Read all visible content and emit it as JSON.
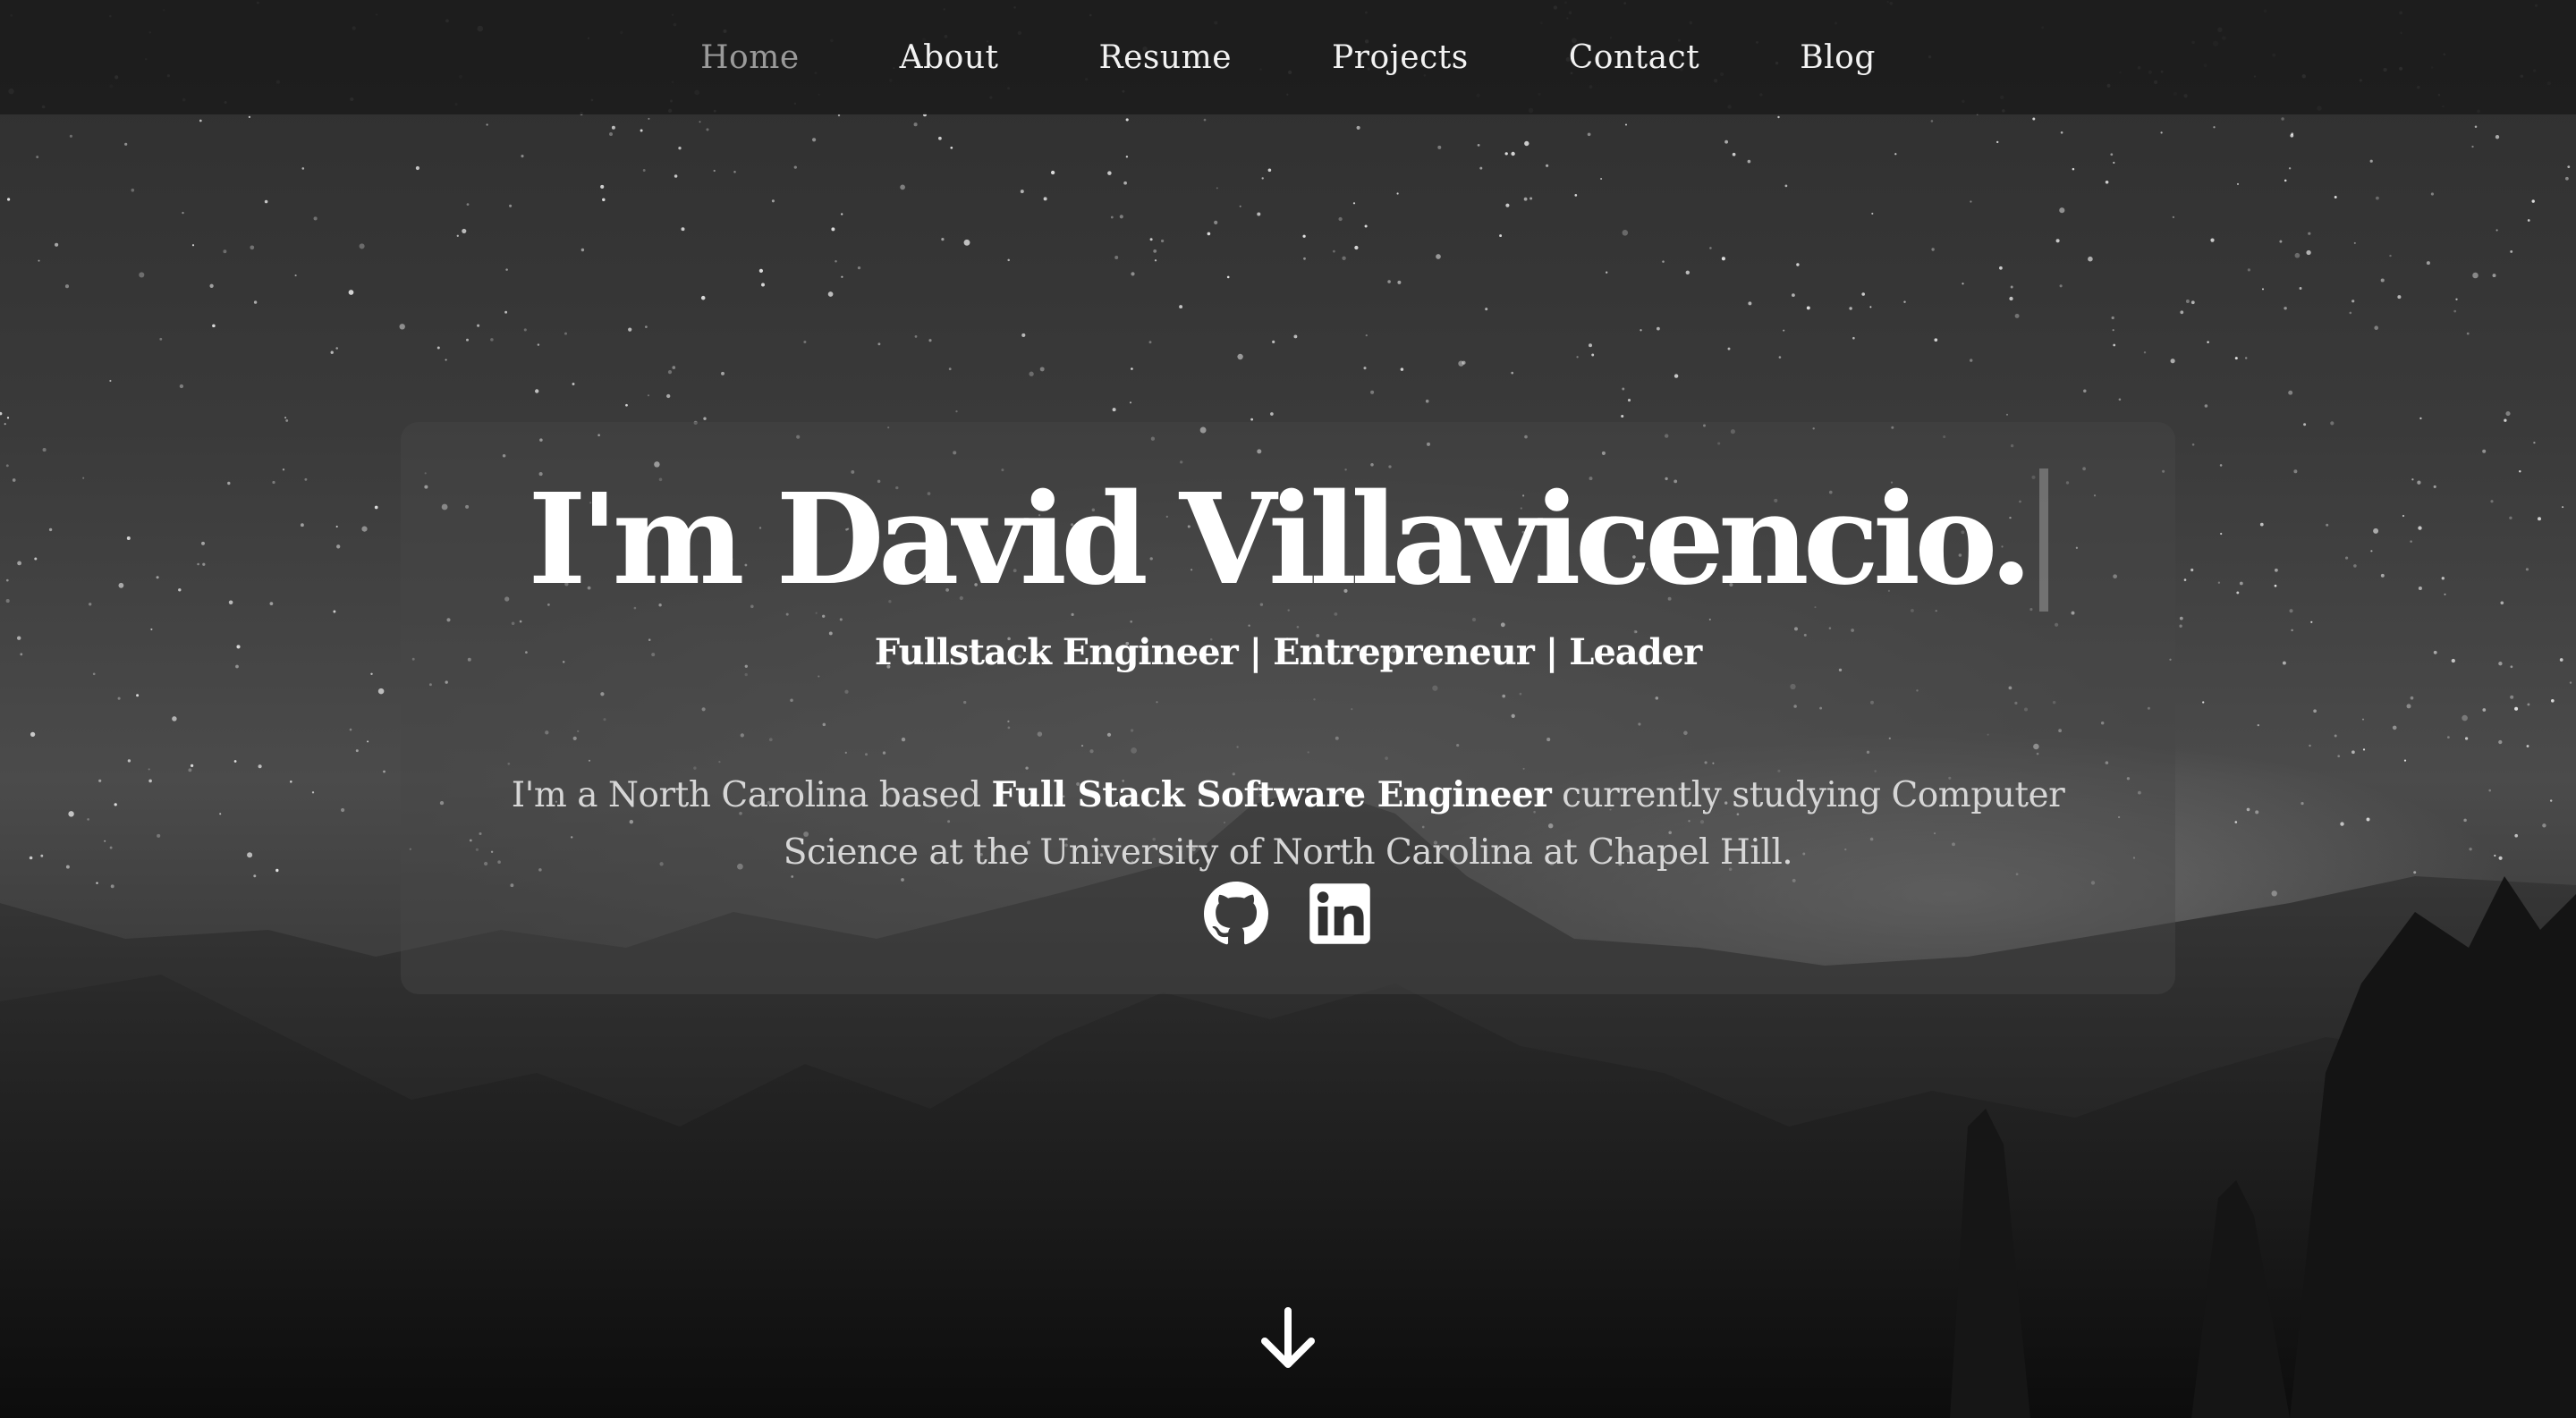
{
  "nav": {
    "items": [
      {
        "label": "Home",
        "active": true
      },
      {
        "label": "About"
      },
      {
        "label": "Resume"
      },
      {
        "label": "Projects"
      },
      {
        "label": "Contact"
      },
      {
        "label": "Blog"
      }
    ]
  },
  "intro": {
    "heading": "I'm David Villavicencio.",
    "tagline": "Fullstack Engineer | Entrepreneur | Leader",
    "bio_prefix": "I'm a North Carolina based ",
    "bio_emphasis": "Full Stack Software Engineer",
    "bio_suffix": " currently studying Computer Science at the University of North Carolina at Chapel Hill."
  },
  "socials": [
    {
      "icon": "github-icon"
    },
    {
      "icon": "linkedin-icon"
    }
  ],
  "scroll": {
    "icon": "arrow-down-icon"
  },
  "colors": {
    "nav_background": "#1c1c1c",
    "nav_active": "#9a9a9a",
    "text": "#ffffff",
    "bio_text": "#d6d6d6"
  }
}
